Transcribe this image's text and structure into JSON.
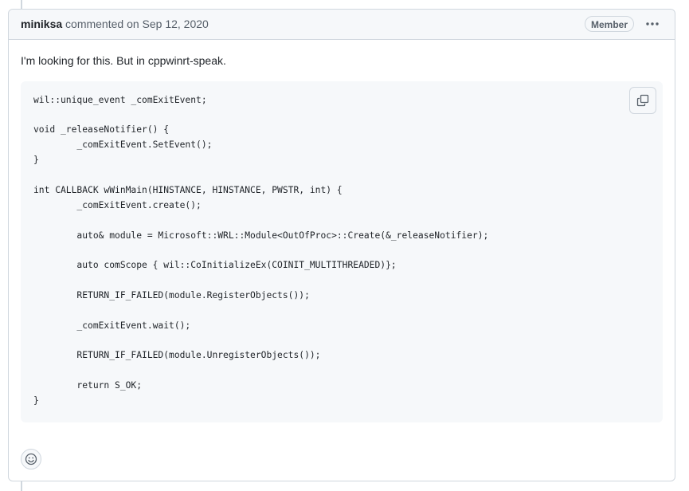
{
  "comment": {
    "author": "miniksa",
    "action": "commented on",
    "date": "Sep 12, 2020",
    "badge": "Member",
    "body_text": "I'm looking for this. But in cppwinrt-speak.",
    "code_lines": [
      "wil::unique_event _comExitEvent;",
      "",
      "void _releaseNotifier() {",
      "        _comExitEvent.SetEvent();",
      "}",
      "",
      "int CALLBACK wWinMain(HINSTANCE, HINSTANCE, PWSTR, int) {",
      "        _comExitEvent.create();",
      "",
      "        auto& module = Microsoft::WRL::Module<OutOfProc>::Create(&_releaseNotifier);",
      "",
      "        auto comScope { wil::CoInitializeEx(COINIT_MULTITHREADED)};",
      "",
      "        RETURN_IF_FAILED(module.RegisterObjects());",
      "",
      "        _comExitEvent.wait();",
      "",
      "        RETURN_IF_FAILED(module.UnregisterObjects());",
      "",
      "        return S_OK;",
      "}"
    ]
  },
  "icons": {
    "menu": "kebab-horizontal-icon",
    "copy": "copy-icon",
    "reaction": "smiley-icon"
  },
  "colors": {
    "border": "#d0d7de",
    "header_bg": "#f6f8fa",
    "code_bg": "#f6f8fa",
    "muted_text": "#57606a",
    "text": "#1f2328"
  }
}
